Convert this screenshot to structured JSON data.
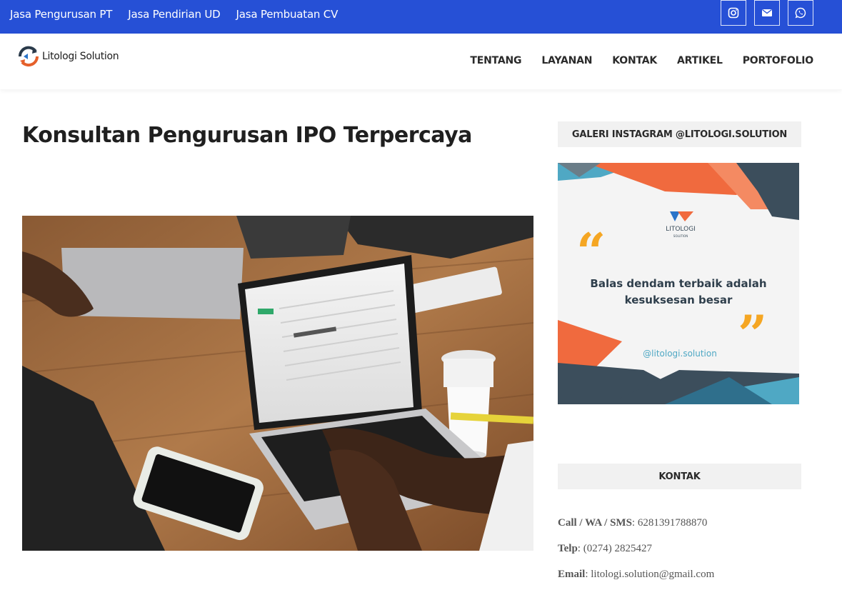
{
  "topbar": {
    "links": [
      "Jasa Pengurusan PT",
      "Jasa Pendirian UD",
      "Jasa Pembuatan CV"
    ],
    "socials": [
      "instagram-icon",
      "envelope-icon",
      "whatsapp-icon"
    ],
    "color": "#2650d6"
  },
  "header": {
    "logo_text": "Litologi Solution",
    "nav": [
      "TENTANG",
      "LAYANAN",
      "KONTAK",
      "ARTIKEL",
      "PORTOFOLIO"
    ]
  },
  "main": {
    "title": "Konsultan Pengurusan IPO Terpercaya"
  },
  "sidebar": {
    "instagram_title": "GALERI INSTAGRAM @LITOLOGI.SOLUTION",
    "insta_post": {
      "brand": "LITOLOGI",
      "brand_sub": "SOLUTION",
      "quote_line1": "Balas dendam terbaik adalah",
      "quote_line2": "kesuksesan besar",
      "handle": "@litologi.solution"
    },
    "contact_title": "KONTAK",
    "contact": {
      "phone_label": "Call / WA / SMS",
      "phone": ": 6281391788870",
      "telp_label": "Telp",
      "telp": ": (0274) 2825427",
      "email_label": "Email",
      "email": ": litologi.solution@gmail.com"
    }
  }
}
